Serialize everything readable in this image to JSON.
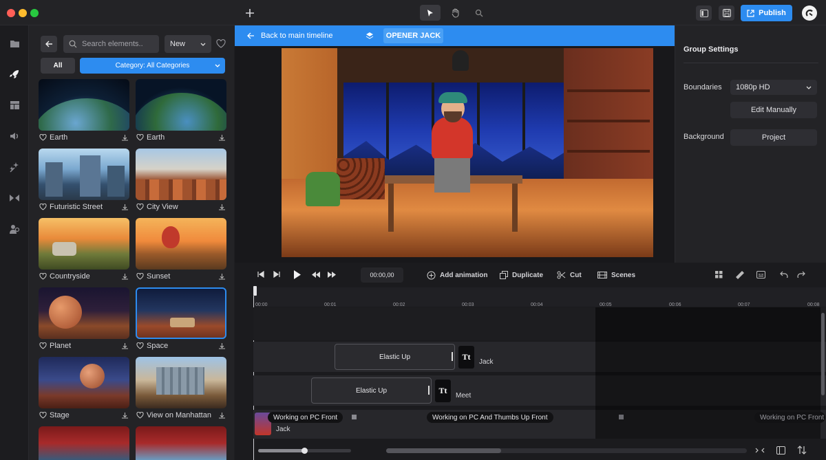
{
  "topbar": {
    "publish_label": "Publish"
  },
  "panel": {
    "search_placeholder": "Search elements..",
    "sort_value": "New",
    "filter_all": "All",
    "category_value": "Category: All Categories",
    "items": [
      {
        "label": "Earth"
      },
      {
        "label": "Earth"
      },
      {
        "label": "Futuristic Street"
      },
      {
        "label": "City View"
      },
      {
        "label": "Countryside"
      },
      {
        "label": "Sunset"
      },
      {
        "label": "Planet"
      },
      {
        "label": "Space"
      },
      {
        "label": "Stage"
      },
      {
        "label": "View on Manhattan"
      }
    ]
  },
  "stage": {
    "back_label": "Back to main timeline",
    "group_name": "OPENER JACK"
  },
  "settings": {
    "title": "Group Settings",
    "boundaries_label": "Boundaries",
    "boundaries_value": "1080p HD",
    "edit_label": "Edit Manually",
    "background_label": "Background",
    "background_value": "Project"
  },
  "timeline": {
    "timecode": "00:00,00",
    "add_animation": "Add animation",
    "duplicate": "Duplicate",
    "cut": "Cut",
    "scenes": "Scenes",
    "ticks": [
      "00:00",
      "00:01",
      "00:02",
      "00:03",
      "00:04",
      "00:05",
      "00:06",
      "00:07",
      "00:08"
    ],
    "track1_anim": "Elastic Up",
    "track1_text": "Jack",
    "track2_anim": "Elastic Up",
    "track2_text": "Meet",
    "text_icon": "Tt",
    "track3_clip1": "Working on PC Front",
    "track3_clip2": "Working on PC And Thumbs Up Front",
    "track3_clip3": "Working on PC Front",
    "track3_name": "Jack"
  },
  "colors": {
    "accent": "#2d8cf0",
    "bg": "#1f1f22"
  }
}
